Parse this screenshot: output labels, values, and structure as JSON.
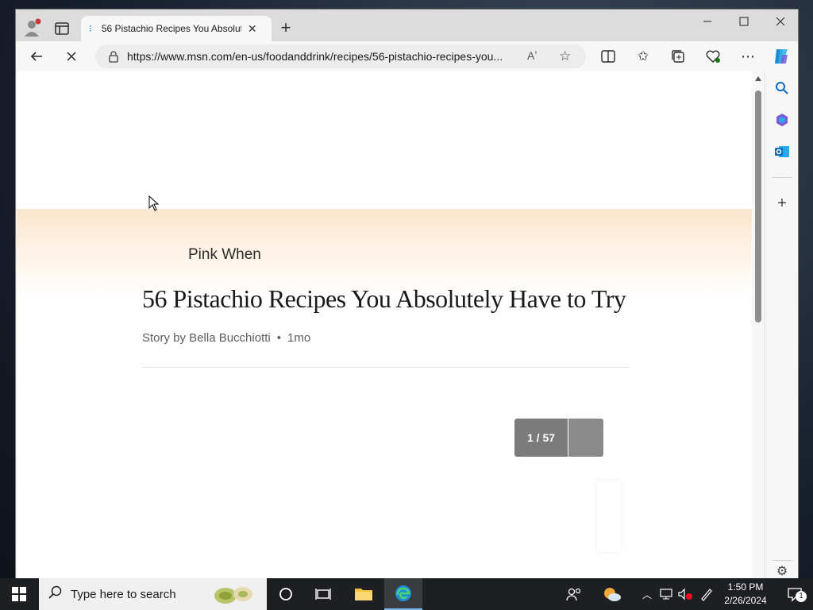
{
  "browser": {
    "tab_title": "56 Pistachio Recipes You Absolut",
    "url": "https://www.msn.com/en-us/foodanddrink/recipes/56-pistachio-recipes-you..."
  },
  "article": {
    "publisher": "Pink When",
    "headline": "56 Pistachio Recipes You Absolutely Have to Try",
    "byline": "Story by Bella Bucchiotti",
    "separator": "•",
    "age": "1mo",
    "slide_counter": "1 / 57"
  },
  "taskbar": {
    "search_placeholder": "Type here to search",
    "time": "1:50 PM",
    "date": "2/26/2024",
    "notification_count": "1"
  },
  "icons": {
    "profile": "profile-icon",
    "tab_actions": "tab-actions-icon",
    "new_tab": "plus-icon",
    "back": "back-arrow-icon",
    "stop": "close-icon",
    "lock": "lock-icon",
    "read_aloud": "read-aloud-icon",
    "favorite": "star-icon",
    "split_screen": "split-screen-icon",
    "favorites": "favorites-icon",
    "collections": "collections-icon",
    "browser_essentials": "heart-pulse-icon",
    "more": "ellipsis-icon",
    "copilot": "copilot-icon",
    "search": "search-icon",
    "m365": "m365-icon",
    "outlook": "outlook-icon",
    "add": "plus-icon",
    "settings": "gear-icon"
  },
  "colors": {
    "hero_gradient": "#fbe6cd",
    "counter_bg": "#7b7b7b",
    "edge_blue": "#0f6cbd"
  }
}
